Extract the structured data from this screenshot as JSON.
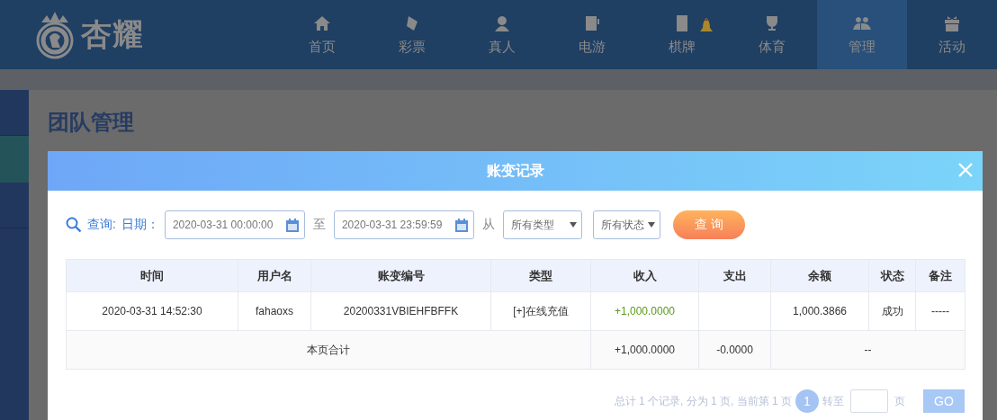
{
  "logo": {
    "text": "杏耀"
  },
  "nav": [
    {
      "label": "首页",
      "kind": "home",
      "selected": false,
      "bell": false
    },
    {
      "label": "彩票",
      "kind": "ticket",
      "selected": false,
      "bell": false
    },
    {
      "label": "真人",
      "kind": "person",
      "selected": false,
      "bell": false
    },
    {
      "label": "电游",
      "kind": "slot",
      "selected": false,
      "bell": false
    },
    {
      "label": "棋牌",
      "kind": "tile",
      "selected": false,
      "bell": true
    },
    {
      "label": "体育",
      "kind": "trophy",
      "selected": false,
      "bell": false
    },
    {
      "label": "管理",
      "kind": "people",
      "selected": true,
      "bell": false
    },
    {
      "label": "活动",
      "kind": "gift",
      "selected": false,
      "bell": false
    }
  ],
  "page": {
    "title": "团队管理"
  },
  "modal": {
    "title": "账变记录",
    "filter": {
      "query_label": "查询:",
      "date_label": "日期：",
      "start": "2020-03-31 00:00:00",
      "to_label": "至",
      "end": "2020-03-31 23:59:59",
      "from_label": "从",
      "type_select": "所有类型",
      "status_select": "所有状态",
      "search_button": "查 询"
    },
    "table": {
      "columns": [
        "时间",
        "用户名",
        "账变编号",
        "类型",
        "收入",
        "支出",
        "余额",
        "状态",
        "备注"
      ],
      "rows": [
        [
          "2020-03-31 14:52:30",
          "fahaoxs",
          "20200331VBIEHFBFFK",
          "[+]在线充值",
          "+1,000.0000",
          "",
          "1,000.3866",
          "成功",
          "-----"
        ]
      ],
      "total": {
        "label": "本页合计",
        "income": "+1,000.0000",
        "expense": "-0.0000",
        "rest": "--"
      }
    },
    "pagination": {
      "summary": "总计 1 个记录, 分为 1 页, 当前第 1 页",
      "current": "1",
      "goto_label": "转至",
      "page_label": "页",
      "go_button": "GO"
    }
  }
}
